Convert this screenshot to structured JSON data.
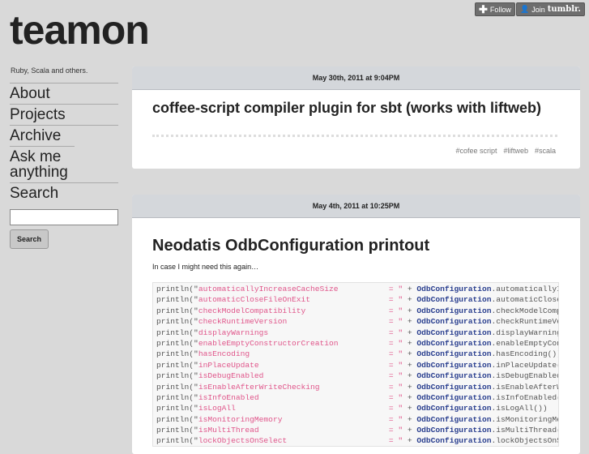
{
  "topbar": {
    "follow": "Follow",
    "join": "Join",
    "join_brand": "tumblr."
  },
  "blog": {
    "title": "teamon",
    "tagline": "Ruby, Scala and others."
  },
  "nav": [
    "About",
    "Projects",
    "Archive",
    "Ask me anything",
    "Search"
  ],
  "search": {
    "button": "Search",
    "value": ""
  },
  "posts": [
    {
      "date": "May 30th, 2011 at 9:04PM",
      "title": "coffee-script compiler plugin for sbt (works with liftweb)",
      "tags": [
        "#cofee script",
        "#liftweb",
        "#scala"
      ]
    },
    {
      "date": "May 4th, 2011 at 10:25PM",
      "title": "Neodatis OdbConfiguration printout",
      "intro": "In case I might need this again…",
      "code": {
        "prefix": "println(\"",
        "eq": "= \"",
        "plus": " + ",
        "cls": "OdbConfiguration",
        "lines": [
          {
            "name": "automaticallyIncreaseCacheSize",
            "call": ".automaticallyIncreaseCacheSize())"
          },
          {
            "name": "automaticCloseFileOnExit",
            "call": ".automaticCloseFileOnExit())"
          },
          {
            "name": "checkModelCompatibility",
            "call": ".checkModelCompatibility())"
          },
          {
            "name": "checkRuntimeVersion",
            "call": ".checkRuntimeVersion())"
          },
          {
            "name": "displayWarnings",
            "call": ".displayWarnings())"
          },
          {
            "name": "enableEmptyConstructorCreation",
            "call": ".enableEmptyConstructorCreation())"
          },
          {
            "name": "hasEncoding",
            "call": ".hasEncoding())"
          },
          {
            "name": "inPlaceUpdate",
            "call": ".inPlaceUpdate())"
          },
          {
            "name": "isDebugEnabled",
            "call": ".isDebugEnabled())"
          },
          {
            "name": "isEnableAfterWriteChecking",
            "call": ".isEnableAfterWriteChecking())"
          },
          {
            "name": "isInfoEnabled",
            "call": ".isInfoEnabled())"
          },
          {
            "name": "isLogAll",
            "call": ".isLogAll())"
          },
          {
            "name": "isMonitoringMemory",
            "call": ".isMonitoringMemory())"
          },
          {
            "name": "isMultiThread",
            "call": ".isMultiThread())"
          },
          {
            "name": "lockObjectsOnSelect",
            "call": ".lockObjectsOnSelect())"
          }
        ]
      }
    }
  ]
}
